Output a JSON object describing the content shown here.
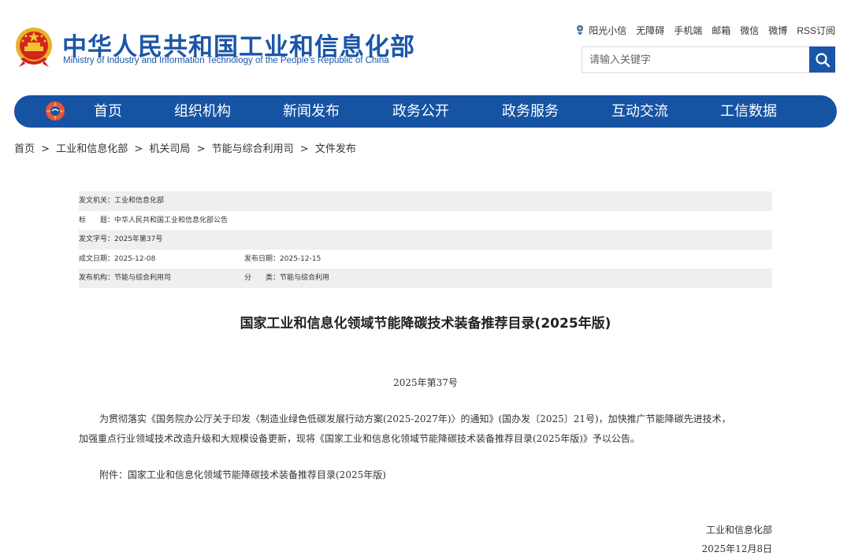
{
  "header": {
    "emblem_icon": "national-emblem-icon",
    "title_cn": "中华人民共和国工业和信息化部",
    "title_en": "Ministry of Industry and Information Technology of the People's Republic of China",
    "brand_color": "#1a56a8"
  },
  "toplinks": [
    {
      "label": "阳光小信",
      "icon": "sunshine-icon"
    },
    {
      "label": "无障碍"
    },
    {
      "label": "手机端"
    },
    {
      "label": "邮箱"
    },
    {
      "label": "微信"
    },
    {
      "label": "微博"
    },
    {
      "label": "RSS订阅"
    }
  ],
  "search": {
    "placeholder": "请输入关键字",
    "button_icon": "search-icon"
  },
  "nav": {
    "logo_icon": "ministry-logo-icon",
    "items": [
      "首页",
      "组织机构",
      "新闻发布",
      "政务公开",
      "政务服务",
      "互动交流",
      "工信数据"
    ],
    "bg_color": "#1653a3"
  },
  "breadcrumb": {
    "items": [
      "首页",
      "工业和信息化部",
      "机关司局",
      "节能与综合利用司",
      "文件发布"
    ],
    "separator": ">"
  },
  "meta": {
    "issuer_label": "发文机关：",
    "issuer": "工业和信息化部",
    "title_label": "标　　题：",
    "title": "中华人民共和国工业和信息化部公告",
    "docno_label": "发文字号：",
    "docno": "2025年第37号",
    "created_label": "成文日期：",
    "created": "2025-12-08",
    "published_label": "发布日期：",
    "published": "2025-12-15",
    "org_label": "发布机构：",
    "org": "节能与综合利用司",
    "category_label": "分　　类：",
    "category": "节能与综合利用"
  },
  "article": {
    "title": "国家工业和信息化领域节能降碳技术装备推荐目录(2025年版)",
    "doc_no": "2025年第37号",
    "para1_line1": "为贯彻落实《国务院办公厅关于印发〈制造业绿色低碳发展行动方案(2025-2027年)〉的通知》(国办发〔2025〕21号)，加快推广节能降碳先进技术，",
    "para1_line2": "加强重点行业领域技术改造升级和大规模设备更新，现将《国家工业和信息化领域节能降碳技术装备推荐目录(2025年版)》予以公告。",
    "attachment": "附件：国家工业和信息化领域节能降碳技术装备推荐目录(2025年版)",
    "signer": "工业和信息化部",
    "sign_date": "2025年12月8日"
  }
}
